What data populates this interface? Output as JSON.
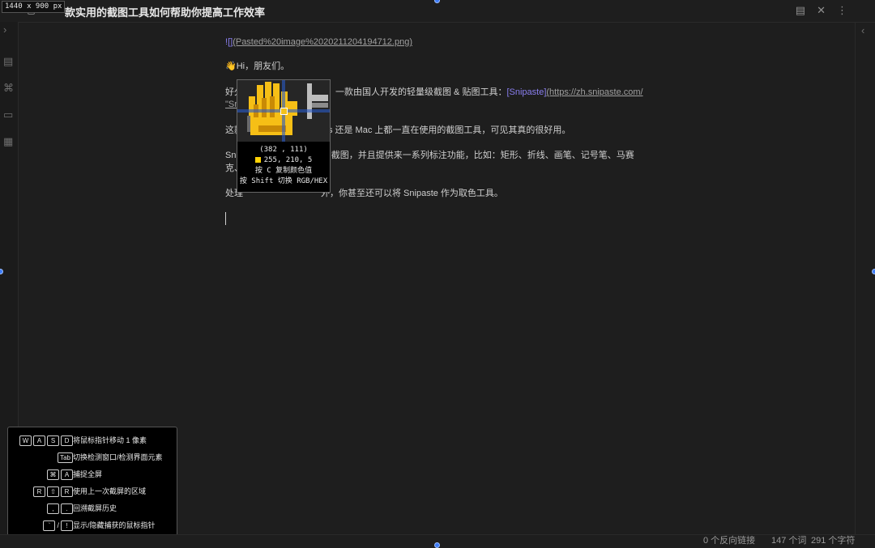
{
  "window": {
    "size_badge": "1440 x 900  px",
    "title": "一款实用的截图工具如何帮助你提高工作效率",
    "top_icons": [
      "reading-view-icon",
      "close-icon",
      "more-options-icon"
    ]
  },
  "left_ribbon": [
    "file-explorer-icon",
    "graph-view-icon",
    "canvas-icon",
    "plugins-icon"
  ],
  "editor": {
    "line1_bang": "!",
    "line1_brackets": "[]",
    "line1_link": "(Pasted%20image%2020211204194712.png)",
    "line2": "👋Hi，朋友们。",
    "line3_pre": "好久",
    "line3_mid": "一款由国人开发的轻量级截图 & 贴图工具：",
    "line3_link_text": "[Snipaste]",
    "line3_link_url": "(https://zh.snipaste.com/",
    "line4": "\"Sn",
    "line5_pre": "这款",
    "line5_post": "ws 还是 Mac 上都一直在使用的截图工具，可见其真的很好用。",
    "line6_pre": "Snipaste",
    "line6_post": "别的截图，并且提供来一系列标注功能，比如：矩形、折线、画笔、记号笔、马赛",
    "line7": "克、文",
    "line8_pre": "处理",
    "line8_post": "外，你甚至还可以将 Snipaste 作为取色工具。"
  },
  "magnifier": {
    "coords": "(382 , 111)",
    "rgb": "255, 210,   5",
    "swatch_color": "#ffd205",
    "hint1": "按 C 复制颜色值",
    "hint2": "按 Shift 切换 RGB/HEX"
  },
  "shortcuts": [
    {
      "keys": [
        "W",
        "A",
        "S",
        "D"
      ],
      "desc": "将鼠标指针移动 1 像素"
    },
    {
      "keys": [
        "Tab"
      ],
      "desc": "切换检测窗口/检测界面元素"
    },
    {
      "keys": [
        "⌘",
        "A"
      ],
      "desc": "捕捉全屏"
    },
    {
      "keys": [
        "R",
        "⇧",
        "R"
      ],
      "desc": "使用上一次截屏的区域"
    },
    {
      "keys": [
        ",",
        "."
      ],
      "desc": "回溯截屏历史"
    },
    {
      "keys": [
        "`",
        "/",
        "!"
      ],
      "desc": "显示/隐藏捕获的鼠标指针"
    }
  ],
  "status": {
    "backlinks": "0 个反向链接",
    "words": "147 个词",
    "chars": "291 个字符"
  },
  "colors": {
    "accent_handle": "#3d7bf7",
    "link_purple": "#8a7ff0",
    "background": "#1e1e1e"
  }
}
